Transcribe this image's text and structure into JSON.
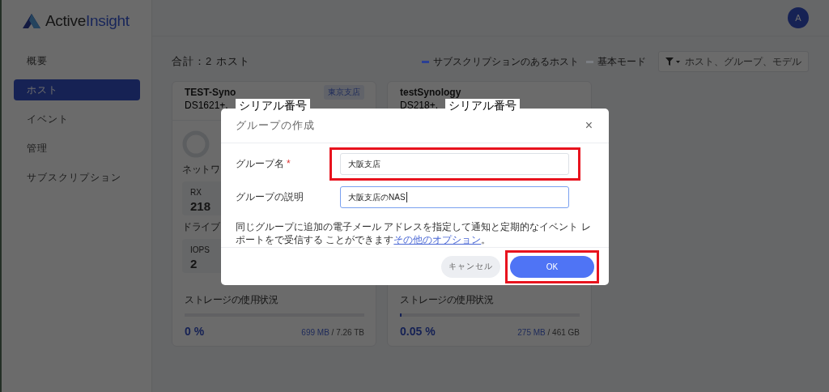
{
  "logo": {
    "text_plain": "Active",
    "text_accent": "Insight"
  },
  "user": {
    "avatar": "A"
  },
  "sidebar": {
    "items": [
      {
        "label": "概要",
        "selected": false
      },
      {
        "label": "ホスト",
        "selected": true
      },
      {
        "label": "イベント",
        "selected": false
      },
      {
        "label": "管理",
        "selected": false
      },
      {
        "label": "サブスクリプション",
        "selected": false
      }
    ]
  },
  "summary": {
    "title": "合計：2 ホスト"
  },
  "legend": [
    {
      "label": "サブスクリプションのあるホスト",
      "color": "#2b3f94"
    },
    {
      "label": "基本モード",
      "color": "#7b7e83"
    }
  ],
  "search": {
    "placeholder": "ホスト、グループ、モデル"
  },
  "hosts": [
    {
      "name": "TEST-Syno",
      "group": "東京支店",
      "model": "DS1621+,",
      "annotation": "シリアル番号",
      "network_label": "ネットワ",
      "rx_label": "RX",
      "rx_value": "218",
      "drive_label": "ドライブ",
      "iops_label": "IOPS",
      "iops_value": "2",
      "storage_label": "ストレージの使用状況",
      "level": 0,
      "percent": "0 %",
      "used": "699 MB",
      "total": "/ 7.26 TB"
    },
    {
      "name": "testSynology",
      "model": "DS218+,",
      "annotation": "シリアル番号",
      "storage_label": "ストレージの使用状況",
      "level": 0.0005,
      "percent": "0.05 %",
      "used": "275 MB",
      "total": "/ 461 GB"
    }
  ],
  "dialog": {
    "title": "グループの作成",
    "close": "×",
    "fields": [
      {
        "label": "グループ名",
        "required_mark": "*",
        "value": "大阪支店",
        "focused": false,
        "highlighted": true
      },
      {
        "label": "グループの説明",
        "value": "大阪支店のNAS",
        "focused": true,
        "highlighted": false
      }
    ],
    "note": "同じグループに追加の電子メール アドレスを指定して通知と定期的なイベント レポートをで受信する ことができます",
    "note_link": "その他のオプション",
    "note_end": "。",
    "buttons": [
      {
        "label": "キャンセル",
        "kind": "secondary",
        "highlighted": false
      },
      {
        "label": "OK",
        "kind": "primary",
        "highlighted": true
      }
    ]
  }
}
